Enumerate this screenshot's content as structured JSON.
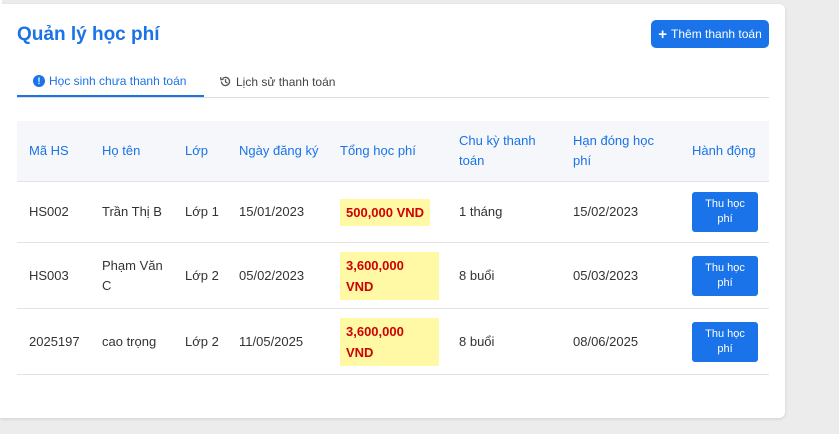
{
  "page": {
    "title": "Quản lý học phí",
    "add_button_label": "Thêm thanh toán"
  },
  "tabs": [
    {
      "label": "Học sinh chưa thanh toán",
      "active": true,
      "icon": "info-icon"
    },
    {
      "label": "Lịch sử thanh toán",
      "active": false,
      "icon": "history-icon"
    }
  ],
  "table": {
    "headers": [
      "Mã HS",
      "Họ tên",
      "Lớp",
      "Ngày đăng ký",
      "Tổng học phí",
      "Chu kỳ thanh toán",
      "Hạn đóng học phí",
      "Hành động"
    ],
    "rows": [
      {
        "id": "HS002",
        "name": "Trần Thị B",
        "class": "Lớp 1",
        "registered": "15/01/2023",
        "fee": "500,000 VND",
        "cycle": "1 tháng",
        "due": "15/02/2023",
        "action": "Thu học phí"
      },
      {
        "id": "HS003",
        "name": "Phạm Văn C",
        "class": "Lớp 2",
        "registered": "05/02/2023",
        "fee": "3,600,000 VND",
        "cycle": "8 buổi",
        "due": "05/03/2023",
        "action": "Thu học phí"
      },
      {
        "id": "2025197",
        "name": "cao trọng",
        "class": "Lớp 2",
        "registered": "11/05/2025",
        "fee": "3,600,000 VND",
        "cycle": "8 buổi",
        "due": "08/06/2025",
        "action": "Thu học phí"
      }
    ]
  },
  "colors": {
    "accent": "#1a73e8",
    "fee_text": "#d00000",
    "fee_highlight": "#fff9a6"
  }
}
